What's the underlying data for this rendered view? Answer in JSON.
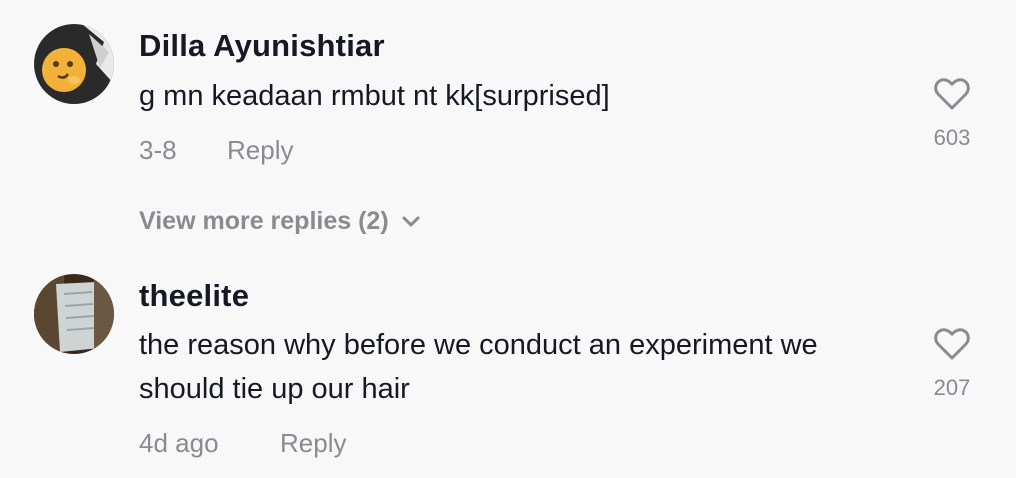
{
  "comments": [
    {
      "username": "Dilla Ayunishtiar",
      "text_lines": [
        "g mn keadaan rmbut nt kk[surprised]"
      ],
      "date": "3-8",
      "reply_label": "Reply",
      "likes": "603",
      "view_more_label": "View more replies (2)"
    },
    {
      "username": "theelite",
      "text_lines": [
        "the reason why before we conduct an experiment we",
        "should tie up our hair"
      ],
      "date": "4d ago",
      "reply_label": "Reply",
      "likes": "207"
    }
  ],
  "icons": {
    "like": "heart-outline-icon",
    "expand": "chevron-down-icon"
  },
  "colors": {
    "background": "#f8f8f8",
    "primary_text": "#161823",
    "secondary_text": "#8a8b91"
  }
}
